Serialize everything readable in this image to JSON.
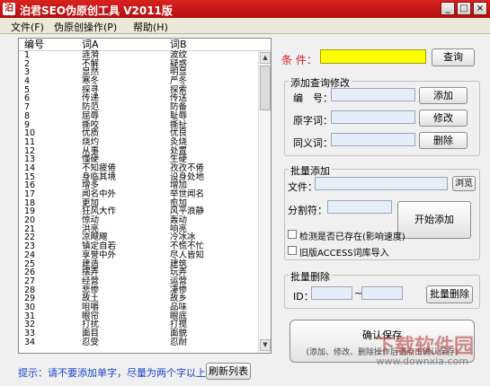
{
  "window": {
    "title": "泊君SEO伪原创工具 V2011版",
    "app_icon": "泊",
    "minimize_label": "_",
    "maximize_label": "□",
    "close_label": "×"
  },
  "menu": {
    "items": [
      {
        "label": "文件(F)"
      },
      {
        "label": "伪原创操作(P)"
      },
      {
        "label": "帮助(H)"
      }
    ]
  },
  "list": {
    "headers": [
      "编号",
      "词A",
      "词B"
    ],
    "rows": [
      [
        "1",
        "涟漪",
        "波纹"
      ],
      [
        "2",
        "不解",
        "疑惑"
      ],
      [
        "3",
        "显然",
        "明显"
      ],
      [
        "4",
        "寒冬",
        "严冬"
      ],
      [
        "5",
        "探寻",
        "探索"
      ],
      [
        "6",
        "传递",
        "传送"
      ],
      [
        "7",
        "防范",
        "防备"
      ],
      [
        "8",
        "屈辱",
        "耻辱"
      ],
      [
        "9",
        "撕咬",
        "撕扯"
      ],
      [
        "10",
        "优质",
        "优良"
      ],
      [
        "11",
        "烧灼",
        "灸烧"
      ],
      [
        "12",
        "从事",
        "处置"
      ],
      [
        "13",
        "懂硬",
        "生硬"
      ],
      [
        "14",
        "不知疲倦",
        "孜孜不倦"
      ],
      [
        "15",
        "身临其境",
        "设身处地"
      ],
      [
        "16",
        "增多",
        "增加"
      ],
      [
        "17",
        "闻名中外",
        "举世闻名"
      ],
      [
        "18",
        "更加",
        "愈加"
      ],
      [
        "19",
        "狂风大作",
        "风平浪静"
      ],
      [
        "20",
        "惊动",
        "轰动"
      ],
      [
        "21",
        "洪亮",
        "响亮"
      ],
      [
        "22",
        "凉飕飕",
        "冷冰冰"
      ],
      [
        "23",
        "镇定自若",
        "不慌不忙"
      ],
      [
        "24",
        "享誉中外",
        "尽人皆知"
      ],
      [
        "25",
        "建造",
        "建筑"
      ],
      [
        "26",
        "摆弄",
        "玩弄"
      ],
      [
        "27",
        "经营",
        "运营"
      ],
      [
        "28",
        "悲惨",
        "凄惨"
      ],
      [
        "29",
        "故土",
        "故乡"
      ],
      [
        "30",
        "咀嚼",
        "品味"
      ],
      [
        "31",
        "眼帘",
        "眼底"
      ],
      [
        "32",
        "打扰",
        "打搅"
      ],
      [
        "33",
        "面目",
        "面貌"
      ],
      [
        "34",
        "忍受",
        "忍耐"
      ]
    ],
    "scroll_up": "▲",
    "scroll_down": "▼"
  },
  "condition": {
    "label": "条 件：",
    "value": "",
    "query_button": "查询"
  },
  "add_edit": {
    "title": "添加查询修改",
    "id_label": "编　号：",
    "orig_label": "原字词：",
    "syn_label": "同义词：",
    "add_button": "添加",
    "edit_button": "修改",
    "delete_button": "删除"
  },
  "batch_add": {
    "title": "批量添加",
    "file_label": "文件：",
    "browse_button": "浏览",
    "separator_label": "分割符：",
    "check_exists": "检测是否已存在(影响速度)",
    "old_access": "旧版ACCESS词库导入",
    "start_button": "开始添加"
  },
  "batch_delete": {
    "title": "批量删除",
    "id_label": "ID：",
    "range_sep": "~",
    "delete_button": "批量删除"
  },
  "save": {
    "button": "确认保存",
    "note": "(添加、修改、删除操作后请点击确认保存)"
  },
  "footer": {
    "tip": "提示：请不要添加单字，尽量为两个字以上。",
    "refresh_button": "刷新列表"
  },
  "watermark": {
    "text": "下载软件园",
    "url": "www.downxia.com"
  },
  "colors": {
    "title_bar": "#c0201c",
    "condition_input": "#ffff00",
    "label_red": "#d42020",
    "tip_blue": "#1a44c8"
  }
}
